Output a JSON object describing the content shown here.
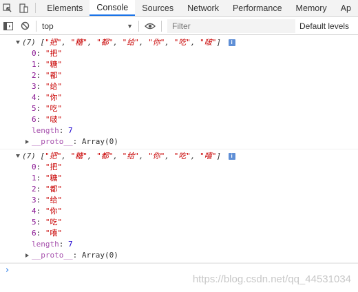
{
  "tabs": [
    {
      "label": "Elements"
    },
    {
      "label": "Console",
      "active": true
    },
    {
      "label": "Sources"
    },
    {
      "label": "Network"
    },
    {
      "label": "Performance"
    },
    {
      "label": "Memory"
    },
    {
      "label": "Ap"
    }
  ],
  "toolbar": {
    "context_value": "top",
    "filter_placeholder": "Filter",
    "levels_label": "Default levels"
  },
  "entries": [
    {
      "length_prefix": "(7)",
      "items": [
        "把",
        "糖",
        "都",
        "给",
        "你",
        "吃",
        "啵"
      ],
      "length_key": "length",
      "length_value": "7",
      "proto_key": "__proto__",
      "proto_value": "Array(0)"
    },
    {
      "length_prefix": "(7)",
      "items": [
        "把",
        "糖",
        "都",
        "给",
        "你",
        "吃",
        "嘻"
      ],
      "length_key": "length",
      "length_value": "7",
      "proto_key": "__proto__",
      "proto_value": "Array(0)"
    }
  ],
  "watermark": "https://blog.csdn.net/qq_44531034",
  "colors": {
    "accent": "#1a73e8",
    "string": "#c80000",
    "key": "#881391",
    "number": "#1c00cf"
  }
}
